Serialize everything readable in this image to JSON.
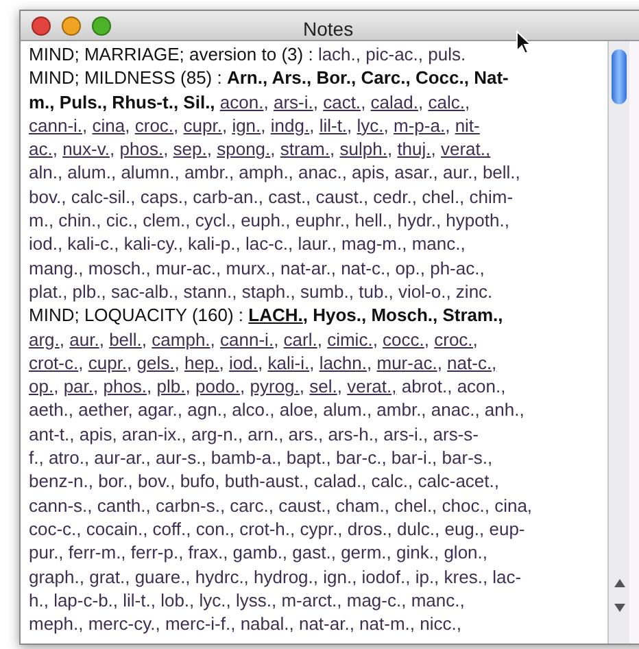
{
  "window": {
    "title": "Notes"
  },
  "lines": [
    [
      {
        "kind": "heading",
        "text": "MIND; MARRIAGE; aversion to (3) : "
      },
      {
        "kind": "plain",
        "text": "lach., pic-ac., puls."
      }
    ],
    [
      {
        "kind": "heading",
        "text": "MIND; MILDNESS (85) : "
      },
      {
        "kind": "bold",
        "text": "Arn., Ars., Bor., Carc., Cocc., Nat-"
      }
    ],
    [
      {
        "kind": "bold",
        "text": "m., Puls., Rhus-t., Sil., "
      },
      {
        "kind": "underline",
        "text": "acon., ars-i., cact., calad., calc.,"
      }
    ],
    [
      {
        "kind": "underline",
        "text": "cann-i., cina, croc., cupr., ign., indg., lil-t., lyc., m-p-a., nit-"
      }
    ],
    [
      {
        "kind": "underline",
        "text": "ac., nux-v., phos., sep., spong., stram., sulph., thuj., verat.,"
      }
    ],
    [
      {
        "kind": "plain",
        "text": "aln., alum., alumn., ambr., amph., anac., apis, asar., aur., bell.,"
      }
    ],
    [
      {
        "kind": "plain",
        "text": "bov., calc-sil., caps., carb-an., cast., caust., cedr., chel., chim-"
      }
    ],
    [
      {
        "kind": "plain",
        "text": "m., chin., cic., clem., cycl., euph., euphr., hell., hydr., hypoth.,"
      }
    ],
    [
      {
        "kind": "plain",
        "text": "iod., kali-c., kali-cy., kali-p., lac-c., laur., mag-m., manc.,"
      }
    ],
    [
      {
        "kind": "plain",
        "text": "mang., mosch., mur-ac., murx., nat-ar., nat-c., op., ph-ac.,"
      }
    ],
    [
      {
        "kind": "plain",
        "text": "plat., plb., sac-alb., stann., staph., sumb., tub., viol-o., zinc."
      }
    ],
    [
      {
        "kind": "heading",
        "text": "MIND; LOQUACITY (160) : "
      },
      {
        "kind": "bold-underline",
        "text": "LACH."
      },
      {
        "kind": "bold",
        "text": ", Hyos., Mosch., Stram.,"
      }
    ],
    [
      {
        "kind": "underline",
        "text": "arg., aur., bell., camph., cann-i., carl., cimic., cocc., croc.,"
      }
    ],
    [
      {
        "kind": "underline",
        "text": "crot-c., cupr., gels., hep., iod., kali-i., lachn., mur-ac., nat-c.,"
      }
    ],
    [
      {
        "kind": "underline",
        "text": "op., par., phos., plb., podo., pyrog., sel., verat.,"
      },
      {
        "kind": "plain",
        "text": " abrot., acon.,"
      }
    ],
    [
      {
        "kind": "plain",
        "text": "aeth., aether, agar., agn., alco., aloe, alum., ambr., anac., anh.,"
      }
    ],
    [
      {
        "kind": "plain",
        "text": "ant-t., apis, aran-ix., arg-n., arn., ars., ars-h., ars-i., ars-s-"
      }
    ],
    [
      {
        "kind": "plain",
        "text": "f., atro., aur-ar., aur-s., bamb-a., bapt., bar-c., bar-i., bar-s.,"
      }
    ],
    [
      {
        "kind": "plain",
        "text": "benz-n., bor., bov., bufo, buth-aust., calad., calc., calc-acet.,"
      }
    ],
    [
      {
        "kind": "plain",
        "text": "cann-s., canth., carbn-s., carc., caust., cham., chel., choc., cina,"
      }
    ],
    [
      {
        "kind": "plain",
        "text": "coc-c., cocain., coff., con., crot-h., cypr., dros., dulc., eug., eup-"
      }
    ],
    [
      {
        "kind": "plain",
        "text": "pur., ferr-m., ferr-p., frax., gamb., gast., germ., gink., glon.,"
      }
    ],
    [
      {
        "kind": "plain",
        "text": "graph., grat., guare., hydrc., hydrog., ign., iodof., ip., kres., lac-"
      }
    ],
    [
      {
        "kind": "plain",
        "text": "h., lap-c-b., lil-t., lob., lyc., lyss., m-arct., mag-c., manc.,"
      }
    ],
    [
      {
        "kind": "plain",
        "text": "meph., merc-cy., merc-i-f., nabal., nat-ar., nat-m., nicc.,"
      }
    ]
  ]
}
